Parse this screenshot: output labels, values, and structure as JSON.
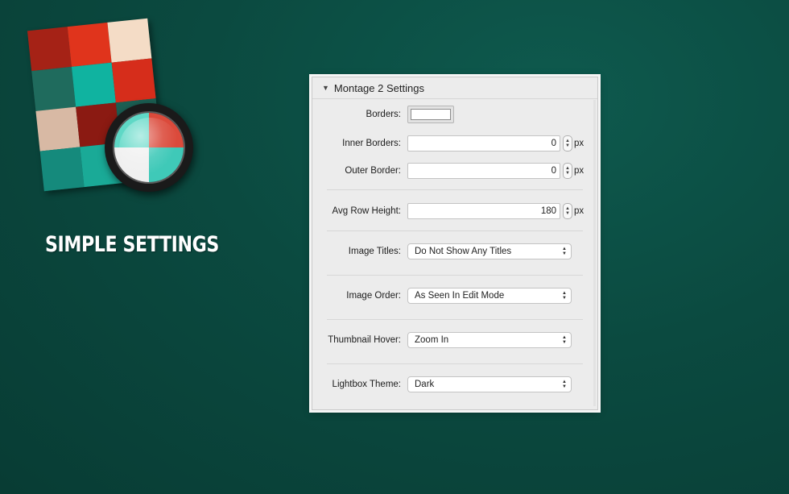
{
  "hero": {
    "headline": "SIMPLE SETTINGS"
  },
  "icon": {
    "name": "montage-app-icon",
    "tiles": [
      "#a52216",
      "#e0341c",
      "#f4dcc6",
      "#1f6b5d",
      "#10b3a0",
      "#d62d1b",
      "#d8b9a4",
      "#8b1a12",
      "#1b5f53",
      "#158a7c",
      "#1aaa97",
      "#c63420",
      "#b42b18",
      "#e3c6b0",
      "#a01f14"
    ],
    "lens_colors": [
      "#5fd8c6",
      "#db4a3b",
      "#f0f0f0",
      "#3fc9b8"
    ]
  },
  "panel": {
    "title": "Montage 2 Settings",
    "borders_label": "Borders:",
    "borders_color": "#ffffff",
    "inner_borders": {
      "label": "Inner Borders:",
      "value": "0",
      "unit": "px"
    },
    "outer_border": {
      "label": "Outer Border:",
      "value": "0",
      "unit": "px"
    },
    "avg_row_height": {
      "label": "Avg Row Height:",
      "value": "180",
      "unit": "px"
    },
    "image_titles": {
      "label": "Image Titles:",
      "value": "Do Not Show Any Titles"
    },
    "image_order": {
      "label": "Image Order:",
      "value": "As Seen In Edit Mode"
    },
    "thumbnail_hover": {
      "label": "Thumbnail Hover:",
      "value": "Zoom In"
    },
    "lightbox_theme": {
      "label": "Lightbox Theme:",
      "value": "Dark"
    }
  }
}
